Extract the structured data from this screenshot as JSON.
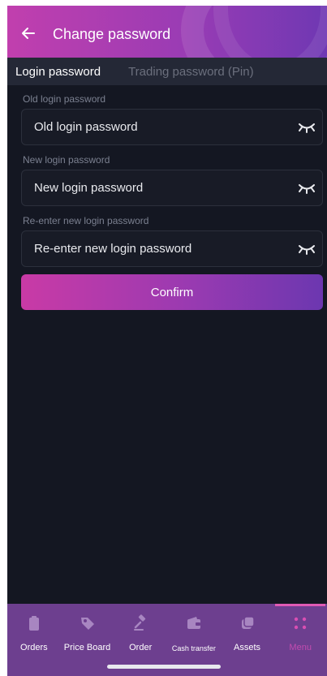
{
  "header": {
    "title": "Change password"
  },
  "tabs": [
    {
      "label": "Login password",
      "active": true
    },
    {
      "label": "Trading password (Pin)",
      "active": false
    }
  ],
  "form": {
    "old": {
      "label": "Old login password",
      "placeholder": "Old login password"
    },
    "new": {
      "label": "New login password",
      "placeholder": "New login password"
    },
    "reenter": {
      "label": "Re-enter new login password",
      "placeholder": "Re-enter new login password"
    },
    "confirm_label": "Confirm"
  },
  "nav": {
    "items": [
      {
        "label": "Orders",
        "icon": "clipboard-icon"
      },
      {
        "label": "Price Board",
        "icon": "price-tag-icon"
      },
      {
        "label": "Order",
        "icon": "gavel-icon"
      },
      {
        "label": "Cash transfer",
        "icon": "wallet-icon"
      },
      {
        "label": "Assets",
        "icon": "coins-icon"
      },
      {
        "label": "Menu",
        "icon": "menu-dots-icon",
        "active": true
      }
    ]
  },
  "colors": {
    "background": "#141722",
    "accent": "#c24bb0",
    "nav_background": "#6d3f8f"
  }
}
